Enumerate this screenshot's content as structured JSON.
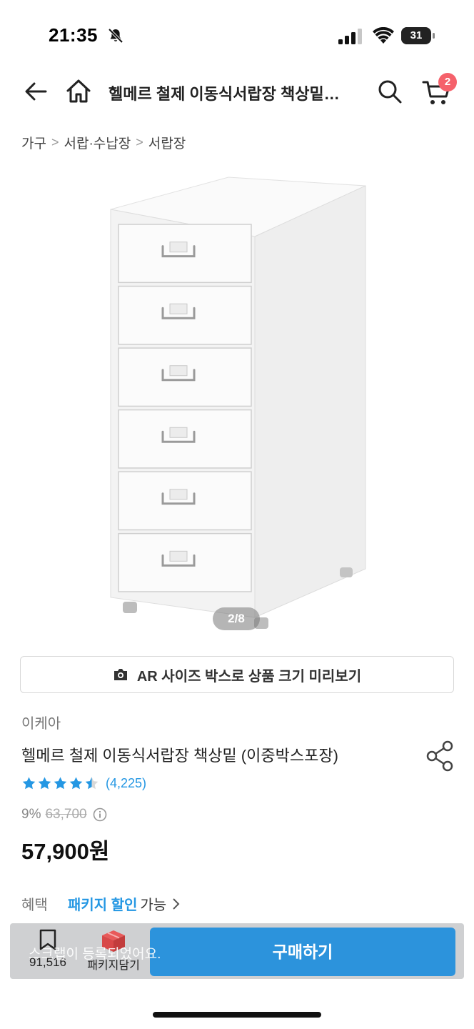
{
  "status_bar": {
    "time": "21:35",
    "battery": "31",
    "battery_level": 0.31
  },
  "header": {
    "title": "헬메르 철제 이동식서랍장 책상밑…",
    "cart_count": "2"
  },
  "breadcrumb": [
    "가구",
    "서랍·수납장",
    "서랍장"
  ],
  "gallery": {
    "counter": "2/8",
    "drawer_count": 6
  },
  "ar_button": {
    "label": "AR 사이즈 박스로 상품 크기 미리보기"
  },
  "product": {
    "brand": "이케아",
    "name": "헬메르 철제 이동식서랍장 책상밑 (이중박스포장)",
    "rating_value": 4.5,
    "review_count": "(4,225)",
    "discount": "9%",
    "original_price": "63,700",
    "price": "57,900원"
  },
  "benefit": {
    "label": "혜택",
    "value": "패키지 할인",
    "suffix": "가능"
  },
  "bottom_bar": {
    "scrap_count": "91,516",
    "package_label": "패키지담기",
    "buy_label": "구매하기",
    "toast": "스크랩이 등록되었어요."
  },
  "colors": {
    "accent": "#2c93dc",
    "star": "#2497e3",
    "badge": "#f5616b"
  }
}
